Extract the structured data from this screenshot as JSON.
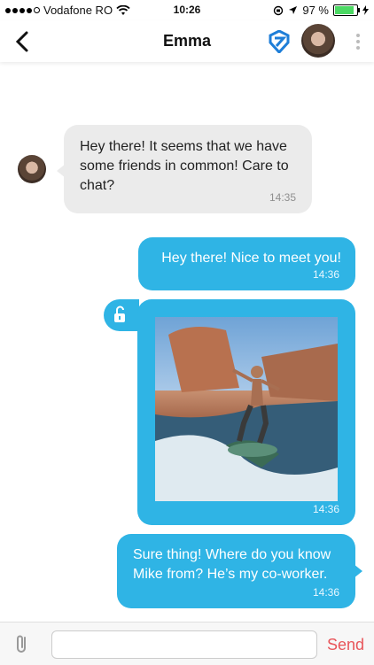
{
  "status_bar": {
    "carrier": "Vodafone RO",
    "time": "10:26",
    "battery_percent": "97 %",
    "battery_level": 0.97
  },
  "nav": {
    "title": "Emma"
  },
  "messages": [
    {
      "direction": "in",
      "text": "Hey there! It seems that we have some friends in common! Care to chat?",
      "time": "14:35"
    },
    {
      "direction": "out",
      "text": "Hey there! Nice to meet you!",
      "time": "14:36"
    },
    {
      "direction": "out",
      "type": "photo",
      "time": "14:36"
    },
    {
      "direction": "out",
      "text": "Sure thing! Where do you know Mike from? He’s my co-worker.",
      "time": "14:36"
    }
  ],
  "input": {
    "value": "",
    "send_label": "Send"
  },
  "colors": {
    "outgoing_bubble": "#2fb4e5",
    "incoming_bubble": "#ebebeb",
    "send_text": "#e8555a"
  }
}
